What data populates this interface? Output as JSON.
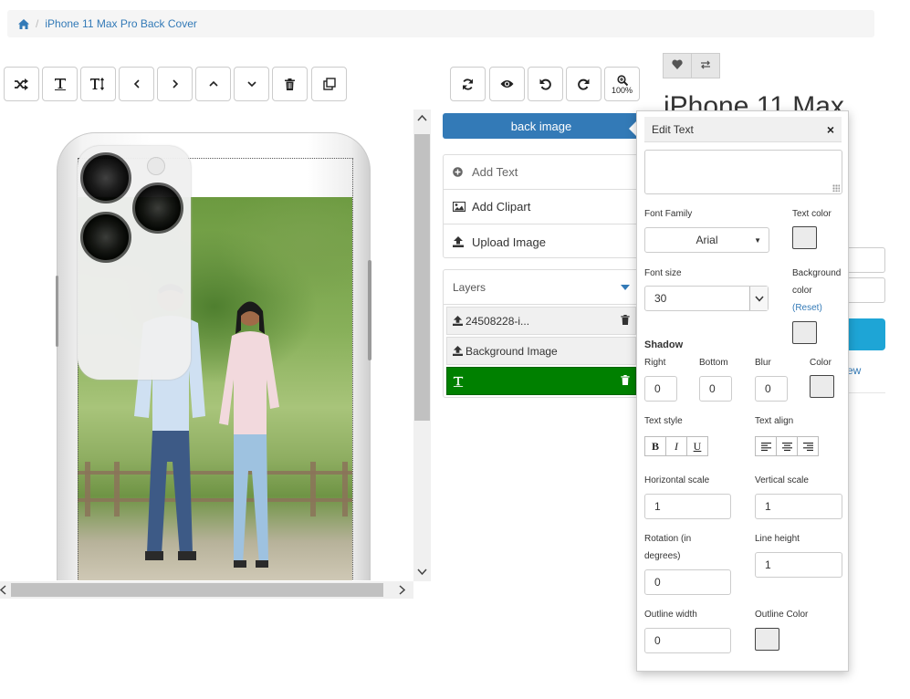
{
  "breadcrumb": {
    "home_icon": "home-icon",
    "current": "iPhone 11 Max Pro Back Cover"
  },
  "toolbar": {
    "left_icons": [
      "shuffle-icon",
      "text-icon",
      "text-height-icon",
      "chevron-left-icon",
      "chevron-right-icon",
      "chevron-up-icon",
      "chevron-down-icon",
      "trash-icon",
      "clone-icon"
    ],
    "right_icons": [
      "refresh-icon",
      "eye-icon",
      "undo-icon",
      "redo-icon",
      "zoom-icon"
    ],
    "zoom_label": "100%"
  },
  "panel": {
    "back_image_label": "back image",
    "actions": [
      {
        "label": "Add Text",
        "icon": "plus-circle-icon"
      },
      {
        "label": "Add Clipart",
        "icon": "image-icon"
      },
      {
        "label": "Upload Image",
        "icon": "upload-icon"
      }
    ],
    "layers_title": "Layers",
    "layers": [
      {
        "label": "24508228-i...",
        "icon": "upload-icon"
      },
      {
        "label": "Background Image",
        "icon": "upload-icon"
      },
      {
        "label": "",
        "icon": "text-icon"
      }
    ]
  },
  "product": {
    "title": "iPhone 11 Max",
    "link_text": "ew"
  },
  "edit_text": {
    "title": "Edit Text",
    "text_value": "",
    "font_family_label": "Font Family",
    "font_family_value": "Arial",
    "text_color_label": "Text color",
    "font_size_label": "Font size",
    "font_size_value": "30",
    "background_label_1": "Background",
    "background_label_2": "color",
    "reset_label": "(Reset)",
    "shadow_label": "Shadow",
    "shadow_right_label": "Right",
    "shadow_bottom_label": "Bottom",
    "shadow_blur_label": "Blur",
    "shadow_color_label": "Color",
    "shadow_right_value": "0",
    "shadow_bottom_value": "0",
    "shadow_blur_value": "0",
    "text_style_label": "Text style",
    "bold_label": "B",
    "italic_label": "I",
    "underline_label": "U",
    "text_align_label": "Text align",
    "horizontal_scale_label": "Horizontal scale",
    "horizontal_scale_value": "1",
    "vertical_scale_label": "Vertical scale",
    "vertical_scale_value": "1",
    "rotation_label_1": "Rotation (in",
    "rotation_label_2": "degrees)",
    "rotation_value": "0",
    "line_height_label": "Line height",
    "line_height_value": "1",
    "outline_width_label": "Outline width",
    "outline_width_value": "0",
    "outline_color_label": "Outline Color"
  },
  "colors": {
    "primary": "#337ab7",
    "active_layer": "#008000",
    "swatch": "#ebebeb",
    "accent_button": "#1ea5d6"
  }
}
